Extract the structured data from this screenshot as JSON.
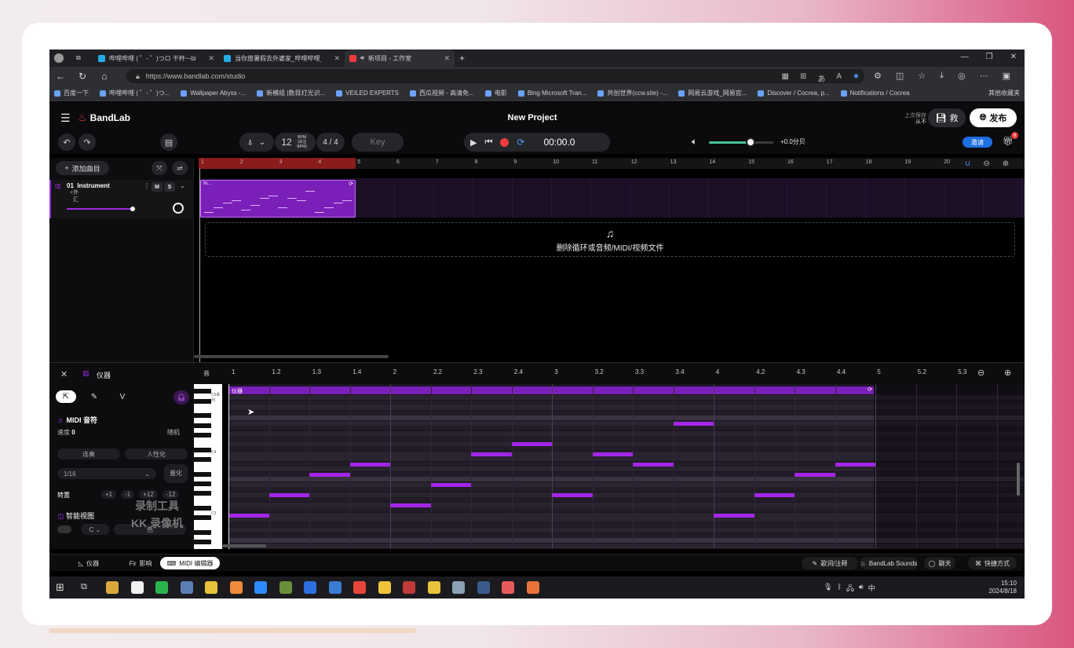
{
  "browser": {
    "tabs": [
      {
        "title": "哔哩哔哩 ( ゜- ゜)つロ 干杯~-bilil",
        "color": "#23ade5"
      },
      {
        "title": "当你放暑假去外婆家_哔哩哔哩_b",
        "color": "#23ade5"
      },
      {
        "title": "新项目 - 工作室",
        "color": "#f23a3a"
      }
    ],
    "url": "https://www.bandlab.com/studio",
    "bookmarks": [
      "百度一下",
      "哔哩哔哩 ( ゜- ゜)つ...",
      "Wallpaper Abyss -...",
      "新模组 |数目灯光识...",
      "VEILED EXPERTS",
      "西瓜视频 - 高清免...",
      "电影",
      "Bing Microsoft Tran...",
      "共创世界(ccw.site) -...",
      "网易云游戏_网易官...",
      "Discover / Cocrea, p...",
      "Notifications / Cocrea"
    ],
    "other_bookmarks": "其他收藏夹"
  },
  "app": {
    "logo": "BandLab",
    "project_title": "New Project",
    "last_saved_line1": "上次保存",
    "last_saved_line2": "从不",
    "save_label": "救",
    "publish_label": "发布",
    "bpm_value": "12",
    "bpm_unit": "BPM (关注 BPM)",
    "time_signature": "4 / 4",
    "key_label": "Key",
    "time_display": "00:00.0",
    "volume_db": "+0.0分贝",
    "volume_level": 0.65,
    "invite_label": "邀请",
    "gift_badge": "6"
  },
  "tracks": {
    "add_track_label": "添加曲目",
    "items": [
      {
        "number": "01",
        "name": "Instrument",
        "sub1": "+外",
        "sub2": "汇",
        "mute": "M",
        "solo": "S",
        "volume_level": 0.8
      }
    ],
    "clip_name": "In...",
    "drop_text": "删除循环或音频/MIDI/视频文件",
    "bar_numbers": [
      "1",
      "2",
      "3",
      "4",
      "5",
      "6",
      "7",
      "8",
      "9",
      "10",
      "11",
      "12",
      "13",
      "14",
      "15",
      "16",
      "17",
      "18",
      "19",
      "20"
    ]
  },
  "editor": {
    "title": "仪器",
    "tools": [
      "pointer",
      "pencil",
      "V"
    ],
    "midi_notes_label": "MIDI 音符",
    "velocity_label": "速度",
    "velocity_value": "0",
    "random_label": "随机",
    "legato_label": "连奏",
    "humanize_label": "人性化",
    "grid_value": "1/16",
    "quantize_label": "量化",
    "transpose_label": "转置",
    "transpose_options": [
      "+1",
      "-1",
      "+12",
      "-12"
    ],
    "smart_view_label": "智能视图",
    "smart_key": "C",
    "smart_scale": "色",
    "region_name": "仪器",
    "key_labels": [
      "C5系列",
      "C4",
      "C3"
    ],
    "beat_ticks": [
      "1",
      "1.2",
      "1.3",
      "1.4",
      "2",
      "2.2",
      "2.3",
      "2.4",
      "3",
      "3.2",
      "3.3",
      "3.4",
      "4",
      "4.2",
      "4.3",
      "4.4",
      "5",
      "5.2",
      "5.3"
    ],
    "notes": [
      {
        "beat": 0.0,
        "pitch": 0
      },
      {
        "beat": 0.25,
        "pitch": 2
      },
      {
        "beat": 0.5,
        "pitch": 4
      },
      {
        "beat": 0.75,
        "pitch": 5
      },
      {
        "beat": 1.0,
        "pitch": 1
      },
      {
        "beat": 1.25,
        "pitch": 3
      },
      {
        "beat": 1.5,
        "pitch": 6
      },
      {
        "beat": 1.75,
        "pitch": 7
      },
      {
        "beat": 2.0,
        "pitch": 2
      },
      {
        "beat": 2.25,
        "pitch": 6
      },
      {
        "beat": 2.5,
        "pitch": 5
      },
      {
        "beat": 2.75,
        "pitch": 9
      },
      {
        "beat": 3.0,
        "pitch": 0
      },
      {
        "beat": 3.25,
        "pitch": 2
      },
      {
        "beat": 3.5,
        "pitch": 4
      },
      {
        "beat": 3.75,
        "pitch": 5
      }
    ]
  },
  "watermark": {
    "line1": "录制工具",
    "line2": "KK 录像机"
  },
  "bottom_bar": {
    "tabs": [
      "仪器",
      "影响",
      "MIDI 编辑器"
    ],
    "right": [
      "歌词/注释",
      "BandLab Sounds",
      "聊天",
      "快捷方式"
    ]
  },
  "taskbar": {
    "time": "15:10",
    "date": "2024/8/18",
    "ime": "中"
  }
}
